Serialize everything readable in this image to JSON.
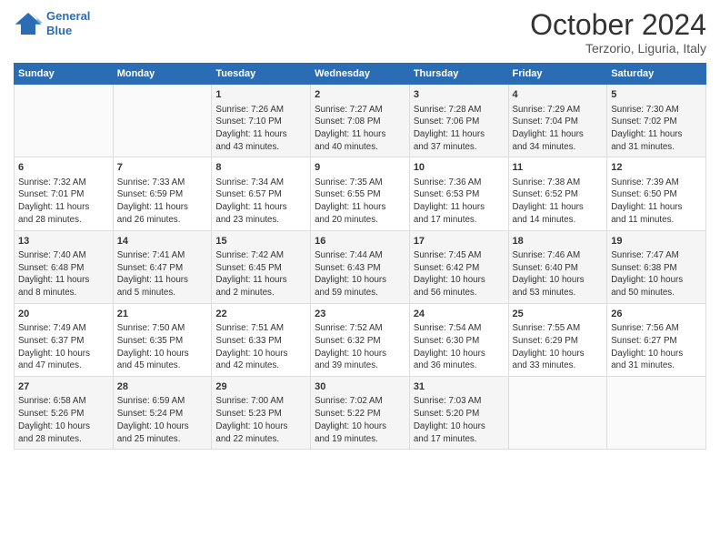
{
  "header": {
    "logo_line1": "General",
    "logo_line2": "Blue",
    "month_title": "October 2024",
    "subtitle": "Terzorio, Liguria, Italy"
  },
  "days_of_week": [
    "Sunday",
    "Monday",
    "Tuesday",
    "Wednesday",
    "Thursday",
    "Friday",
    "Saturday"
  ],
  "weeks": [
    [
      {
        "day": "",
        "info": ""
      },
      {
        "day": "",
        "info": ""
      },
      {
        "day": "1",
        "info": "Sunrise: 7:26 AM\nSunset: 7:10 PM\nDaylight: 11 hours\nand 43 minutes."
      },
      {
        "day": "2",
        "info": "Sunrise: 7:27 AM\nSunset: 7:08 PM\nDaylight: 11 hours\nand 40 minutes."
      },
      {
        "day": "3",
        "info": "Sunrise: 7:28 AM\nSunset: 7:06 PM\nDaylight: 11 hours\nand 37 minutes."
      },
      {
        "day": "4",
        "info": "Sunrise: 7:29 AM\nSunset: 7:04 PM\nDaylight: 11 hours\nand 34 minutes."
      },
      {
        "day": "5",
        "info": "Sunrise: 7:30 AM\nSunset: 7:02 PM\nDaylight: 11 hours\nand 31 minutes."
      }
    ],
    [
      {
        "day": "6",
        "info": "Sunrise: 7:32 AM\nSunset: 7:01 PM\nDaylight: 11 hours\nand 28 minutes."
      },
      {
        "day": "7",
        "info": "Sunrise: 7:33 AM\nSunset: 6:59 PM\nDaylight: 11 hours\nand 26 minutes."
      },
      {
        "day": "8",
        "info": "Sunrise: 7:34 AM\nSunset: 6:57 PM\nDaylight: 11 hours\nand 23 minutes."
      },
      {
        "day": "9",
        "info": "Sunrise: 7:35 AM\nSunset: 6:55 PM\nDaylight: 11 hours\nand 20 minutes."
      },
      {
        "day": "10",
        "info": "Sunrise: 7:36 AM\nSunset: 6:53 PM\nDaylight: 11 hours\nand 17 minutes."
      },
      {
        "day": "11",
        "info": "Sunrise: 7:38 AM\nSunset: 6:52 PM\nDaylight: 11 hours\nand 14 minutes."
      },
      {
        "day": "12",
        "info": "Sunrise: 7:39 AM\nSunset: 6:50 PM\nDaylight: 11 hours\nand 11 minutes."
      }
    ],
    [
      {
        "day": "13",
        "info": "Sunrise: 7:40 AM\nSunset: 6:48 PM\nDaylight: 11 hours\nand 8 minutes."
      },
      {
        "day": "14",
        "info": "Sunrise: 7:41 AM\nSunset: 6:47 PM\nDaylight: 11 hours\nand 5 minutes."
      },
      {
        "day": "15",
        "info": "Sunrise: 7:42 AM\nSunset: 6:45 PM\nDaylight: 11 hours\nand 2 minutes."
      },
      {
        "day": "16",
        "info": "Sunrise: 7:44 AM\nSunset: 6:43 PM\nDaylight: 10 hours\nand 59 minutes."
      },
      {
        "day": "17",
        "info": "Sunrise: 7:45 AM\nSunset: 6:42 PM\nDaylight: 10 hours\nand 56 minutes."
      },
      {
        "day": "18",
        "info": "Sunrise: 7:46 AM\nSunset: 6:40 PM\nDaylight: 10 hours\nand 53 minutes."
      },
      {
        "day": "19",
        "info": "Sunrise: 7:47 AM\nSunset: 6:38 PM\nDaylight: 10 hours\nand 50 minutes."
      }
    ],
    [
      {
        "day": "20",
        "info": "Sunrise: 7:49 AM\nSunset: 6:37 PM\nDaylight: 10 hours\nand 47 minutes."
      },
      {
        "day": "21",
        "info": "Sunrise: 7:50 AM\nSunset: 6:35 PM\nDaylight: 10 hours\nand 45 minutes."
      },
      {
        "day": "22",
        "info": "Sunrise: 7:51 AM\nSunset: 6:33 PM\nDaylight: 10 hours\nand 42 minutes."
      },
      {
        "day": "23",
        "info": "Sunrise: 7:52 AM\nSunset: 6:32 PM\nDaylight: 10 hours\nand 39 minutes."
      },
      {
        "day": "24",
        "info": "Sunrise: 7:54 AM\nSunset: 6:30 PM\nDaylight: 10 hours\nand 36 minutes."
      },
      {
        "day": "25",
        "info": "Sunrise: 7:55 AM\nSunset: 6:29 PM\nDaylight: 10 hours\nand 33 minutes."
      },
      {
        "day": "26",
        "info": "Sunrise: 7:56 AM\nSunset: 6:27 PM\nDaylight: 10 hours\nand 31 minutes."
      }
    ],
    [
      {
        "day": "27",
        "info": "Sunrise: 6:58 AM\nSunset: 5:26 PM\nDaylight: 10 hours\nand 28 minutes."
      },
      {
        "day": "28",
        "info": "Sunrise: 6:59 AM\nSunset: 5:24 PM\nDaylight: 10 hours\nand 25 minutes."
      },
      {
        "day": "29",
        "info": "Sunrise: 7:00 AM\nSunset: 5:23 PM\nDaylight: 10 hours\nand 22 minutes."
      },
      {
        "day": "30",
        "info": "Sunrise: 7:02 AM\nSunset: 5:22 PM\nDaylight: 10 hours\nand 19 minutes."
      },
      {
        "day": "31",
        "info": "Sunrise: 7:03 AM\nSunset: 5:20 PM\nDaylight: 10 hours\nand 17 minutes."
      },
      {
        "day": "",
        "info": ""
      },
      {
        "day": "",
        "info": ""
      }
    ]
  ]
}
